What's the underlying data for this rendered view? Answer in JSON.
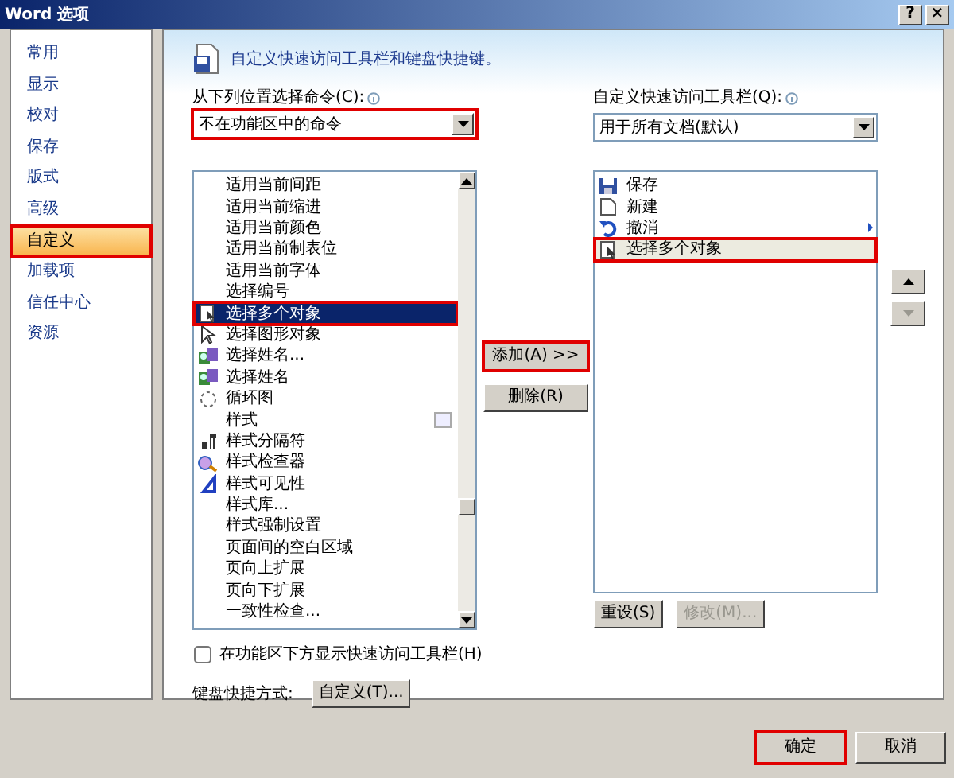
{
  "window": {
    "title": "Word 选项",
    "buttons": [
      {
        "label": "?"
      },
      {
        "label": "×"
      }
    ]
  },
  "sidebar": {
    "items": [
      {
        "label": "常用",
        "selected": false,
        "highlighted": false
      },
      {
        "label": "显示",
        "selected": false,
        "highlighted": false
      },
      {
        "label": "校对",
        "selected": false,
        "highlighted": false
      },
      {
        "label": "保存",
        "selected": false,
        "highlighted": false
      },
      {
        "label": "版式",
        "selected": false,
        "highlighted": false
      },
      {
        "label": "高级",
        "selected": false,
        "highlighted": false
      },
      {
        "label": "自定义",
        "selected": true,
        "highlighted": true
      },
      {
        "label": "加载项",
        "selected": false,
        "highlighted": false
      },
      {
        "label": "信任中心",
        "selected": false,
        "highlighted": false
      },
      {
        "label": "资源",
        "selected": false,
        "highlighted": false
      }
    ]
  },
  "header": {
    "title": "自定义快速访问工具栏和键盘快捷键。"
  },
  "source": {
    "label": "从下列位置选择命令(C):",
    "value": "不在功能区中的命令",
    "highlighted": true
  },
  "commands": [
    {
      "label": "适用当前间距",
      "kind": "plain",
      "selected": false,
      "highlighted": false
    },
    {
      "label": "适用当前缩进",
      "kind": "plain",
      "selected": false,
      "highlighted": false
    },
    {
      "label": "适用当前颜色",
      "kind": "plain",
      "selected": false,
      "highlighted": false
    },
    {
      "label": "适用当前制表位",
      "kind": "plain",
      "selected": false,
      "highlighted": false
    },
    {
      "label": "适用当前字体",
      "kind": "plain",
      "selected": false,
      "highlighted": false
    },
    {
      "label": "选择编号",
      "kind": "plain",
      "selected": false,
      "highlighted": false
    },
    {
      "label": "选择多个对象",
      "kind": "multiselect",
      "selected": true,
      "highlighted": true
    },
    {
      "label": "选择图形对象",
      "kind": "pointer",
      "selected": false,
      "highlighted": false
    },
    {
      "label": "选择姓名...",
      "kind": "names",
      "selected": false,
      "highlighted": false
    },
    {
      "label": "选择姓名",
      "kind": "names",
      "selected": false,
      "highlighted": false
    },
    {
      "label": "循环图",
      "kind": "cycle",
      "selected": false,
      "highlighted": false
    },
    {
      "label": "样式",
      "kind": "dropdown",
      "selected": false,
      "highlighted": false
    },
    {
      "label": "样式分隔符",
      "kind": "separator",
      "selected": false,
      "highlighted": false
    },
    {
      "label": "样式检查器",
      "kind": "inspector",
      "selected": false,
      "highlighted": false
    },
    {
      "label": "样式可见性",
      "kind": "visibility",
      "selected": false,
      "highlighted": false
    },
    {
      "label": "样式库...",
      "kind": "plain",
      "selected": false,
      "highlighted": false
    },
    {
      "label": "样式强制设置",
      "kind": "plain",
      "selected": false,
      "highlighted": false
    },
    {
      "label": "页面间的空白区域",
      "kind": "plain",
      "selected": false,
      "highlighted": false
    },
    {
      "label": "页向上扩展",
      "kind": "plain",
      "selected": false,
      "highlighted": false
    },
    {
      "label": "页向下扩展",
      "kind": "plain",
      "selected": false,
      "highlighted": false
    },
    {
      "label": "一致性检查...",
      "kind": "plain",
      "selected": false,
      "highlighted": false
    }
  ],
  "add_button": {
    "label": "添加(A) >>",
    "highlighted": true
  },
  "remove_button": {
    "label": "删除(R)"
  },
  "target": {
    "label": "自定义快速访问工具栏(Q):",
    "value": "用于所有文档(默认)"
  },
  "toolbar_items": [
    {
      "label": "保存",
      "kind": "save",
      "selected": false,
      "highlighted": false
    },
    {
      "label": "新建",
      "kind": "new",
      "selected": false,
      "highlighted": false
    },
    {
      "label": "撤消",
      "kind": "undo",
      "selected": false,
      "highlighted": false
    },
    {
      "label": "选择多个对象",
      "kind": "multiselect",
      "selected": true,
      "highlighted": true
    }
  ],
  "move_buttons": [
    {
      "kind": "up",
      "disabled": false
    },
    {
      "kind": "down",
      "disabled": true
    }
  ],
  "reset_button": {
    "label": "重设(S)",
    "disabled": false
  },
  "modify_button": {
    "label": "修改(M)...",
    "disabled": true
  },
  "show_below": {
    "label": "在功能区下方显示快速访问工具栏(H)",
    "checked": false
  },
  "shortcuts": {
    "label": "键盘快捷方式:",
    "button": "自定义(T)..."
  },
  "footer": {
    "buttons": [
      {
        "label": "确定",
        "highlighted": true
      },
      {
        "label": "取消",
        "highlighted": false
      }
    ]
  }
}
